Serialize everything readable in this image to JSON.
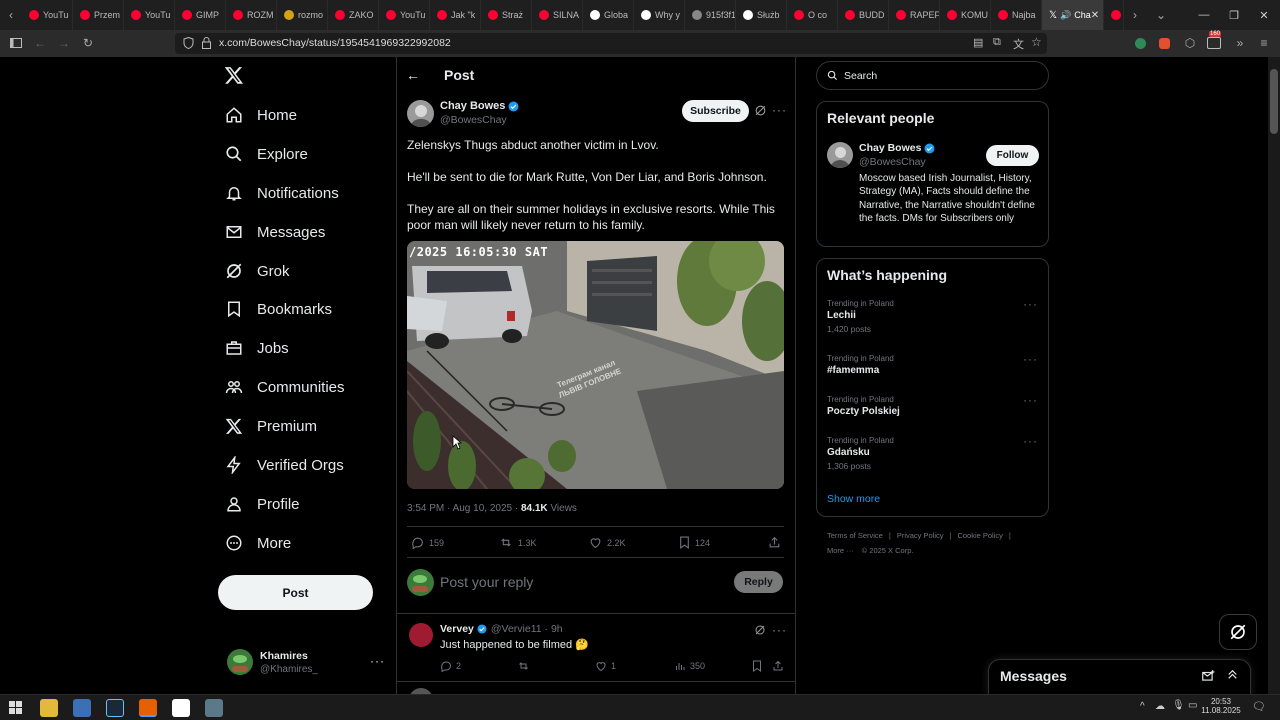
{
  "browser": {
    "tabs": [
      {
        "label": "YouTu",
        "color": "#ff0033"
      },
      {
        "label": "Przem",
        "color": "#ff0033"
      },
      {
        "label": "YouTu",
        "color": "#ff0033"
      },
      {
        "label": "GIMP",
        "color": "#ff0033"
      },
      {
        "label": "ROZM",
        "color": "#ff0033"
      },
      {
        "label": "rozmo",
        "color": "#d4a017"
      },
      {
        "label": "ZAKO",
        "color": "#ff0033"
      },
      {
        "label": "YouTu",
        "color": "#ff0033"
      },
      {
        "label": "Jak \"k",
        "color": "#ff0033"
      },
      {
        "label": "Straż",
        "color": "#ff0033"
      },
      {
        "label": "SILNA",
        "color": "#ff0033"
      },
      {
        "label": "Globa",
        "color": "#ffffff"
      },
      {
        "label": "Why y",
        "color": "#ffffff"
      },
      {
        "label": "915f3f112",
        "color": "#888888"
      },
      {
        "label": "Służb",
        "color": "#ffffff"
      },
      {
        "label": "O co",
        "color": "#ff0033"
      },
      {
        "label": "BUDD",
        "color": "#ff0033"
      },
      {
        "label": "RAPEF",
        "color": "#ff0033"
      },
      {
        "label": "KOMU",
        "color": "#ff0033"
      },
      {
        "label": "Najba",
        "color": "#ff0033"
      }
    ],
    "active_tab": "Cha",
    "url": "x.com/BowesChay/status/1954541969322992082",
    "extension_badge": "160"
  },
  "nav": {
    "items": [
      {
        "label": "Home",
        "icon": "home-icon"
      },
      {
        "label": "Explore",
        "icon": "search-icon"
      },
      {
        "label": "Notifications",
        "icon": "bell-icon"
      },
      {
        "label": "Messages",
        "icon": "mail-icon"
      },
      {
        "label": "Grok",
        "icon": "grok-icon"
      },
      {
        "label": "Bookmarks",
        "icon": "bookmark-icon"
      },
      {
        "label": "Jobs",
        "icon": "briefcase-icon"
      },
      {
        "label": "Communities",
        "icon": "people-icon"
      },
      {
        "label": "Premium",
        "icon": "x-logo-icon"
      },
      {
        "label": "Verified Orgs",
        "icon": "lightning-icon"
      },
      {
        "label": "Profile",
        "icon": "person-icon"
      },
      {
        "label": "More",
        "icon": "more-circle-icon"
      }
    ],
    "post_label": "Post",
    "account": {
      "name": "Khamires",
      "handle": "@Khamires_"
    }
  },
  "post": {
    "header_title": "Post",
    "author_name": "Chay Bowes",
    "author_handle": "@BowesChay",
    "subscribe_label": "Subscribe",
    "text_lines": [
      "Zelenskys Thugs abduct another victim in Lvov.",
      "He'll be sent to die for Mark Rutte, Von Der Liar, and Boris Johnson.",
      "They are all on their summer holidays in exclusive resorts. While This poor man will likely never return to his family."
    ],
    "media": {
      "timestamp_overlay": "/2025 16:05:30 SAT",
      "watermark_line1": "Телеграм канал",
      "watermark_line2": "ЛЬВІВ ГОЛОВНЕ"
    },
    "meta_time": "3:54 PM · Aug 10, 2025 ·",
    "views_count": "84.1K",
    "views_label": "Views",
    "stats": {
      "replies": "159",
      "reposts": "1.3K",
      "likes": "2.2K",
      "bookmarks": "124"
    },
    "reply_placeholder": "Post your reply",
    "reply_button": "Reply"
  },
  "reply": {
    "name": "Vervey",
    "handle": "@Vervie11 · 9h",
    "text": "Just happened to be filmed 🤔",
    "stats": {
      "replies": "2",
      "likes": "1",
      "views": "350"
    }
  },
  "sidebar": {
    "search_placeholder": "Search",
    "relevant_title": "Relevant people",
    "person": {
      "name": "Chay Bowes",
      "handle": "@BowesChay",
      "follow_label": "Follow",
      "bio": "Moscow based Irish Journalist, History, Strategy (MA), Facts should define the Narrative, the Narrative shouldn't define the facts. DMs for Subscribers only"
    },
    "happening_title": "What’s happening",
    "trends": [
      {
        "category": "Trending in Poland",
        "name": "Lechii",
        "count": "1,420 posts"
      },
      {
        "category": "Trending in Poland",
        "name": "#famemma",
        "count": ""
      },
      {
        "category": "Trending in Poland",
        "name": "Poczty Polskiej",
        "count": ""
      },
      {
        "category": "Trending in Poland",
        "name": "Gdańsku",
        "count": "1,306 posts"
      }
    ],
    "show_more": "Show more",
    "footer_links": [
      "Terms of Service",
      "Privacy Policy",
      "Cookie Policy"
    ],
    "footer_more": "More ···",
    "footer_copyright": "© 2025 X Corp.",
    "messages_label": "Messages"
  },
  "taskbar": {
    "time": "20:53",
    "date": "11.08.2025"
  },
  "colors": {
    "accent": "#1d9bf0",
    "verified": "#1d9bf0",
    "border": "#2f3336",
    "muted": "#71767b"
  }
}
